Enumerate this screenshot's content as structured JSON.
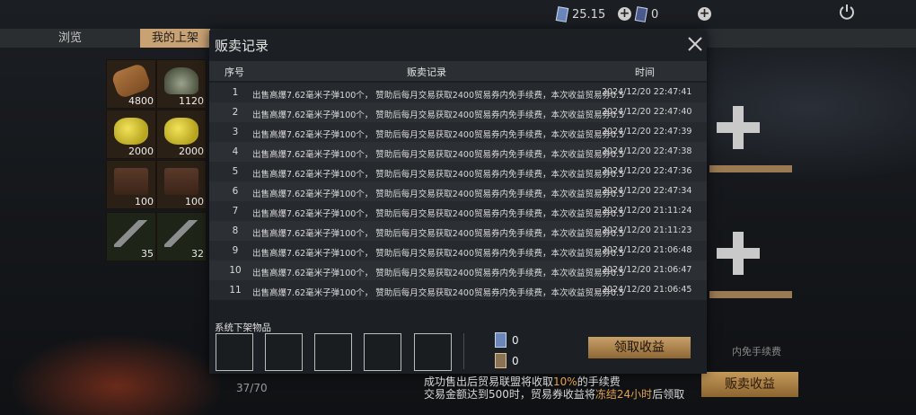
{
  "topbar": {
    "currency_1": "25.15",
    "currency_2": "0"
  },
  "tabs": [
    {
      "label": "浏览"
    },
    {
      "label": "我的上架"
    }
  ],
  "inventory": {
    "items": [
      {
        "icon": "logs-icon",
        "count": "4800"
      },
      {
        "icon": "tank-icon",
        "count": "1120"
      },
      {
        "icon": "gold-ore-icon",
        "count": "2000"
      },
      {
        "icon": "gold-ore-icon",
        "count": "2000"
      },
      {
        "icon": "ammo-box-icon",
        "count": "100"
      },
      {
        "icon": "ammo-box-icon",
        "count": "100"
      },
      {
        "icon": "rifle-icon",
        "count": "35"
      },
      {
        "icon": "rifle-icon",
        "count": "32"
      }
    ],
    "capacity": "37/70"
  },
  "right_panel": {
    "note": "内免手续费",
    "sell_button": "贩卖收益"
  },
  "modal": {
    "title": "贩卖记录",
    "columns": [
      "序号",
      "贩卖记录",
      "时间"
    ],
    "rows": [
      {
        "no": "1",
        "desc": "出售高爆7.62毫米子弹100个， 赞助后每月交易获取2400贸易券内免手续费，本次收益贸易券0.5",
        "time": "2024/12/20 22:47:41"
      },
      {
        "no": "2",
        "desc": "出售高爆7.62毫米子弹100个， 赞助后每月交易获取2400贸易券内免手续费，本次收益贸易券0.5",
        "time": "2024/12/20 22:47:40"
      },
      {
        "no": "3",
        "desc": "出售高爆7.62毫米子弹100个， 赞助后每月交易获取2400贸易券内免手续费，本次收益贸易券0.5",
        "time": "2024/12/20 22:47:39"
      },
      {
        "no": "4",
        "desc": "出售高爆7.62毫米子弹100个， 赞助后每月交易获取2400贸易券内免手续费，本次收益贸易券0.5",
        "time": "2024/12/20 22:47:38"
      },
      {
        "no": "5",
        "desc": "出售高爆7.62毫米子弹100个， 赞助后每月交易获取2400贸易券内免手续费，本次收益贸易券0.5",
        "time": "2024/12/20 22:47:36"
      },
      {
        "no": "6",
        "desc": "出售高爆7.62毫米子弹100个， 赞助后每月交易获取2400贸易券内免手续费，本次收益贸易券0.5",
        "time": "2024/12/20 22:47:34"
      },
      {
        "no": "7",
        "desc": "出售高爆7.62毫米子弹100个， 赞助后每月交易获取2400贸易券内免手续费，本次收益贸易券0.5",
        "time": "2024/12/20 21:11:24"
      },
      {
        "no": "8",
        "desc": "出售高爆7.62毫米子弹100个， 赞助后每月交易获取2400贸易券内免手续费，本次收益贸易券0.5",
        "time": "2024/12/20 21:11:23"
      },
      {
        "no": "9",
        "desc": "出售高爆7.62毫米子弹100个， 赞助后每月交易获取2400贸易券内免手续费，本次收益贸易券0.5",
        "time": "2024/12/20 21:06:48"
      },
      {
        "no": "10",
        "desc": "出售高爆7.62毫米子弹100个， 赞助后每月交易获取2400贸易券内免手续费，本次收益贸易券0.5",
        "time": "2024/12/20 21:06:47"
      },
      {
        "no": "11",
        "desc": "出售高爆7.62毫米子弹100个， 赞助后每月交易获取2400贸易券内免手续费，本次收益贸易券0.5",
        "time": "2024/12/20 21:06:45"
      }
    ],
    "system_removed_title": "系统下架物品",
    "ticket_amount": "0",
    "card_amount": "0",
    "claim_button": "领取收益"
  },
  "notice": {
    "line1_prefix": "成功售出后贸易联盟将收取",
    "line1_highlight": "10%",
    "line1_suffix": "的手续费",
    "line2_prefix": "交易金额达到500时，贸易券收益将",
    "line2_highlight": "冻结24小时",
    "line2_suffix": "后领取"
  }
}
